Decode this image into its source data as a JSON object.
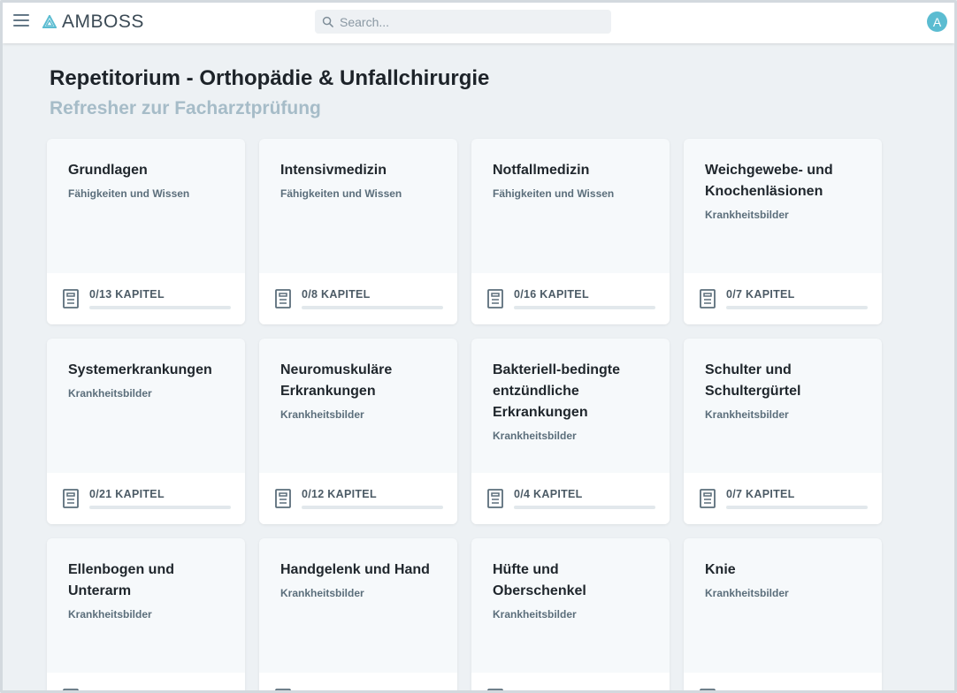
{
  "app": {
    "name": "AMBOSS"
  },
  "search": {
    "placeholder": "Search..."
  },
  "user": {
    "initial": "A"
  },
  "page": {
    "title": "Repetitorium - Orthopädie & Unfallchirurgie",
    "subtitle": "Refresher zur Facharztprüfung"
  },
  "colors": {
    "accent": "#5bbcd1",
    "subtitle": "#a6bcc8"
  },
  "cards": [
    {
      "title": "Grundlagen",
      "tag": "Fähigkeiten und Wissen",
      "chapters": "0/13 KAPITEL",
      "progress": 0
    },
    {
      "title": "Intensivmedizin",
      "tag": "Fähigkeiten und Wissen",
      "chapters": "0/8 KAPITEL",
      "progress": 0
    },
    {
      "title": "Notfallmedizin",
      "tag": "Fähigkeiten und Wissen",
      "chapters": "0/16 KAPITEL",
      "progress": 0
    },
    {
      "title": "Weichgewebe- und Knochenläsionen",
      "tag": "Krankheitsbilder",
      "chapters": "0/7 KAPITEL",
      "progress": 0
    },
    {
      "title": "Systemerkrankungen",
      "tag": "Krankheitsbilder",
      "chapters": "0/21 KAPITEL",
      "progress": 0
    },
    {
      "title": "Neuromuskuläre Erkrankungen",
      "tag": "Krankheitsbilder",
      "chapters": "0/12 KAPITEL",
      "progress": 0
    },
    {
      "title": "Bakteriell-bedingte entzündliche Erkrankungen",
      "tag": "Krankheitsbilder",
      "chapters": "0/4 KAPITEL",
      "progress": 0
    },
    {
      "title": "Schulter und Schultergürtel",
      "tag": "Krankheitsbilder",
      "chapters": "0/7 KAPITEL",
      "progress": 0
    },
    {
      "title": "Ellenbogen und Unterarm",
      "tag": "Krankheitsbilder",
      "chapters": "",
      "progress": 0
    },
    {
      "title": "Handgelenk und Hand",
      "tag": "Krankheitsbilder",
      "chapters": "",
      "progress": 0
    },
    {
      "title": "Hüfte und Oberschenkel",
      "tag": "Krankheitsbilder",
      "chapters": "",
      "progress": 0
    },
    {
      "title": "Knie",
      "tag": "Krankheitsbilder",
      "chapters": "",
      "progress": 0
    }
  ]
}
